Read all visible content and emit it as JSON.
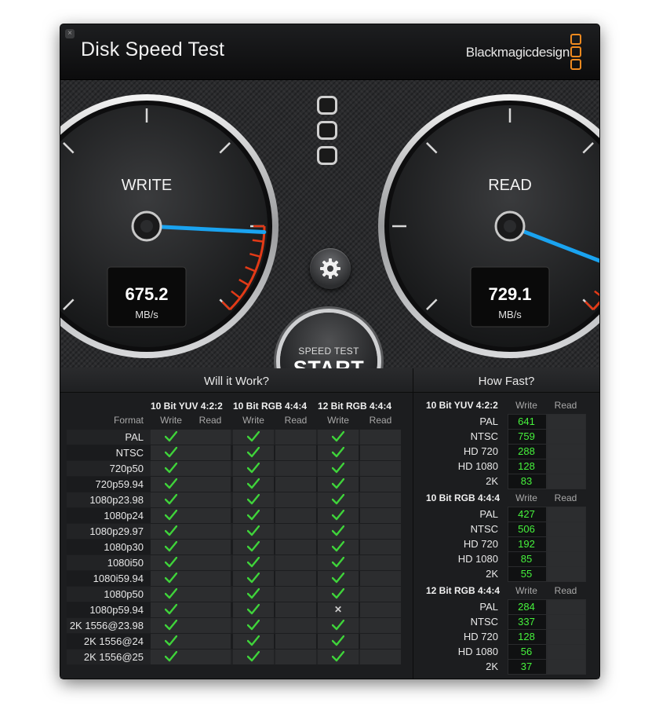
{
  "window": {
    "title": "Disk Speed Test",
    "brand": "Blackmagicdesign",
    "close_glyph": "×"
  },
  "gauges": {
    "write": {
      "label": "WRITE",
      "value": "675.2",
      "unit": "MB/s",
      "max_mbps": 800
    },
    "read": {
      "label": "READ",
      "value": "729.1",
      "unit": "MB/s",
      "max_mbps": 800
    }
  },
  "controls": {
    "settings_icon": "gear-icon",
    "start_small": "SPEED TEST",
    "start_big": "START"
  },
  "will_it_work": {
    "title": "Will it Work?",
    "format_header": "Format",
    "groups": [
      "10 Bit YUV 4:2:2",
      "10 Bit RGB 4:4:4",
      "12 Bit RGB 4:4:4"
    ],
    "sub_headers": [
      "Write",
      "Read"
    ],
    "rows": [
      {
        "format": "PAL",
        "write": [
          "ok",
          "ok",
          "ok"
        ]
      },
      {
        "format": "NTSC",
        "write": [
          "ok",
          "ok",
          "ok"
        ]
      },
      {
        "format": "720p50",
        "write": [
          "ok",
          "ok",
          "ok"
        ]
      },
      {
        "format": "720p59.94",
        "write": [
          "ok",
          "ok",
          "ok"
        ]
      },
      {
        "format": "1080p23.98",
        "write": [
          "ok",
          "ok",
          "ok"
        ]
      },
      {
        "format": "1080p24",
        "write": [
          "ok",
          "ok",
          "ok"
        ]
      },
      {
        "format": "1080p29.97",
        "write": [
          "ok",
          "ok",
          "ok"
        ]
      },
      {
        "format": "1080p30",
        "write": [
          "ok",
          "ok",
          "ok"
        ]
      },
      {
        "format": "1080i50",
        "write": [
          "ok",
          "ok",
          "ok"
        ]
      },
      {
        "format": "1080i59.94",
        "write": [
          "ok",
          "ok",
          "ok"
        ]
      },
      {
        "format": "1080p50",
        "write": [
          "ok",
          "ok",
          "ok"
        ]
      },
      {
        "format": "1080p59.94",
        "write": [
          "ok",
          "ok",
          "fail"
        ]
      },
      {
        "format": "2K 1556@23.98",
        "write": [
          "ok",
          "ok",
          "ok"
        ]
      },
      {
        "format": "2K 1556@24",
        "write": [
          "ok",
          "ok",
          "ok"
        ]
      },
      {
        "format": "2K 1556@25",
        "write": [
          "ok",
          "ok",
          "ok"
        ]
      }
    ]
  },
  "how_fast": {
    "title": "How Fast?",
    "sub_headers": [
      "Write",
      "Read"
    ],
    "groups": [
      {
        "name": "10 Bit YUV 4:2:2",
        "rows": [
          {
            "format": "PAL",
            "write": "641",
            "read": ""
          },
          {
            "format": "NTSC",
            "write": "759",
            "read": ""
          },
          {
            "format": "HD 720",
            "write": "288",
            "read": ""
          },
          {
            "format": "HD 1080",
            "write": "128",
            "read": ""
          },
          {
            "format": "2K",
            "write": "83",
            "read": ""
          }
        ]
      },
      {
        "name": "10 Bit RGB 4:4:4",
        "rows": [
          {
            "format": "PAL",
            "write": "427",
            "read": ""
          },
          {
            "format": "NTSC",
            "write": "506",
            "read": ""
          },
          {
            "format": "HD 720",
            "write": "192",
            "read": ""
          },
          {
            "format": "HD 1080",
            "write": "85",
            "read": ""
          },
          {
            "format": "2K",
            "write": "55",
            "read": ""
          }
        ]
      },
      {
        "name": "12 Bit RGB 4:4:4",
        "rows": [
          {
            "format": "PAL",
            "write": "284",
            "read": ""
          },
          {
            "format": "NTSC",
            "write": "337",
            "read": ""
          },
          {
            "format": "HD 720",
            "write": "128",
            "read": ""
          },
          {
            "format": "HD 1080",
            "write": "56",
            "read": ""
          },
          {
            "format": "2K",
            "write": "37",
            "read": ""
          }
        ]
      }
    ]
  },
  "colors": {
    "accent_orange": "#f08a1f",
    "needle_blue": "#1aa3f0",
    "value_green": "#46f23c",
    "redline": "#e23a17",
    "check_green": "#3fd43a"
  }
}
